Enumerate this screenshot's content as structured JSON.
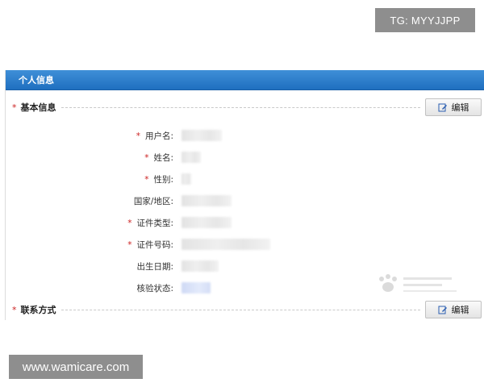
{
  "overlay": {
    "tg_label": "TG: MYYJJPP",
    "site_label": "www.wamicare.com"
  },
  "panel": {
    "title": "个人信息"
  },
  "sections": {
    "basic": {
      "title": "基本信息",
      "edit_label": "编辑"
    },
    "contact": {
      "title": "联系方式",
      "edit_label": "编辑"
    }
  },
  "fields": [
    {
      "label": "用户名:",
      "required": true
    },
    {
      "label": "姓名:",
      "required": true
    },
    {
      "label": "性别:",
      "required": true
    },
    {
      "label": "国家/地区:",
      "required": false
    },
    {
      "label": "证件类型:",
      "required": true
    },
    {
      "label": "证件号码:",
      "required": true
    },
    {
      "label": "出生日期:",
      "required": false
    },
    {
      "label": "核验状态:",
      "required": false
    }
  ],
  "icons": {
    "edit": "edit-pencil-icon",
    "required": "asterisk"
  },
  "colors": {
    "header": "#1f6fc0",
    "required": "#cc2222"
  }
}
